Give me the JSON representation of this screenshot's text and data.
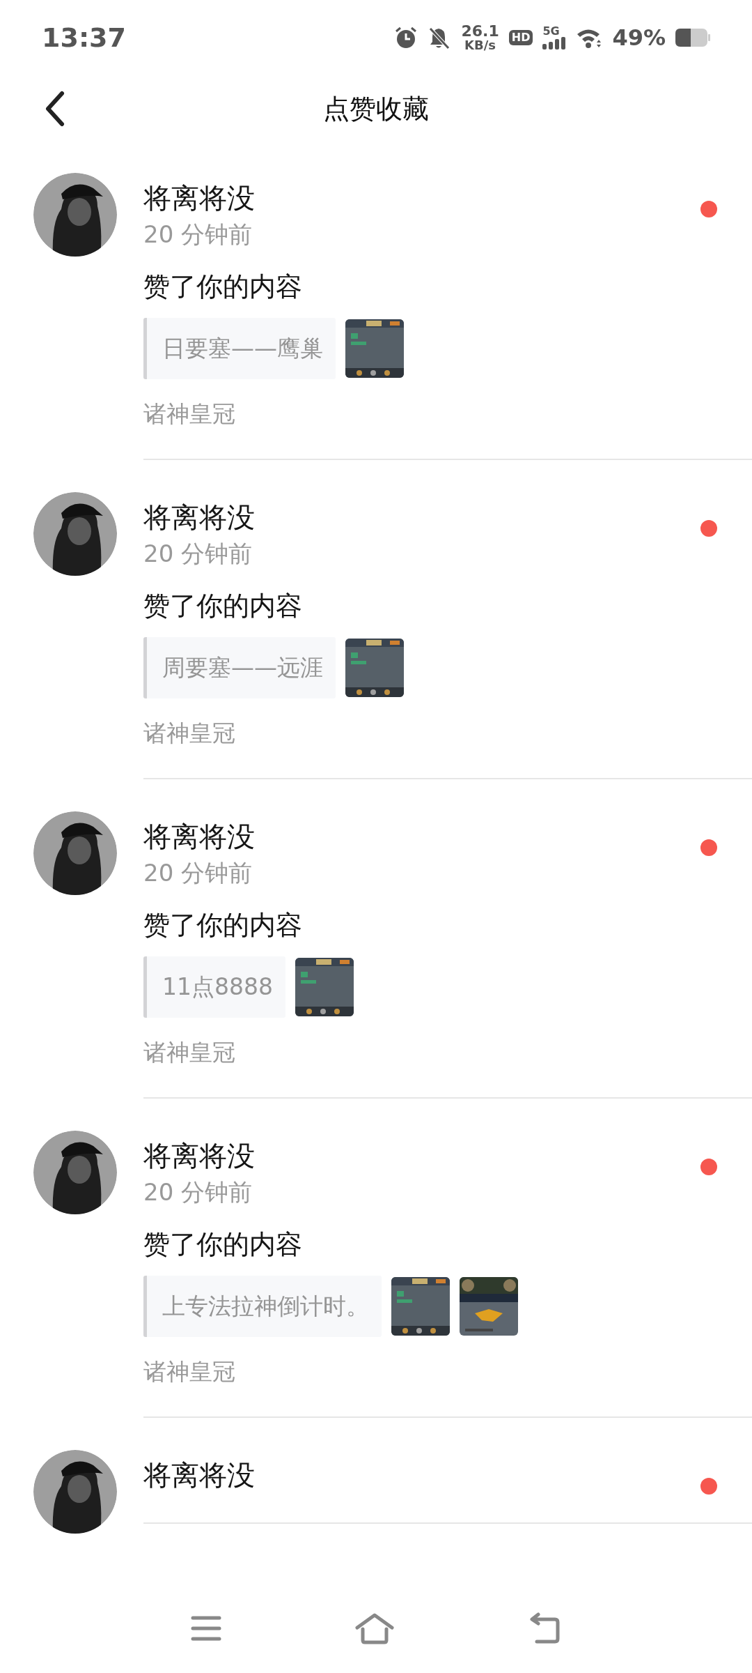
{
  "status_bar": {
    "time": "13:37",
    "speed_value": "26.1",
    "speed_unit": "KB/s",
    "hd_label": "HD",
    "network_label": "5G",
    "battery": "49%"
  },
  "header": {
    "title": "点赞收藏"
  },
  "notifications": [
    {
      "user": "将离将没",
      "time": "20 分钟前",
      "action": "赞了你的内容",
      "quote": "日要塞——鹰巢",
      "tag": "诸神皇冠",
      "unread": true
    },
    {
      "user": "将离将没",
      "time": "20 分钟前",
      "action": "赞了你的内容",
      "quote": "周要塞——远涯",
      "tag": "诸神皇冠",
      "unread": true
    },
    {
      "user": "将离将没",
      "time": "20 分钟前",
      "action": "赞了你的内容",
      "quote": "11点8888",
      "tag": "诸神皇冠",
      "unread": true
    },
    {
      "user": "将离将没",
      "time": "20 分钟前",
      "action": "赞了你的内容",
      "quote": "上专法拉神倒计时。",
      "tag": "诸神皇冠",
      "unread": true
    },
    {
      "user": "将离将没",
      "unread": true
    }
  ]
}
